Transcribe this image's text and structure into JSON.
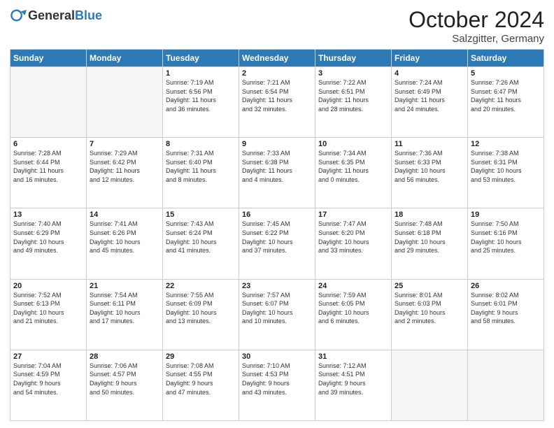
{
  "header": {
    "logo_general": "General",
    "logo_blue": "Blue",
    "month_title": "October 2024",
    "location": "Salzgitter, Germany"
  },
  "weekdays": [
    "Sunday",
    "Monday",
    "Tuesday",
    "Wednesday",
    "Thursday",
    "Friday",
    "Saturday"
  ],
  "weeks": [
    [
      {
        "day": "",
        "info": ""
      },
      {
        "day": "",
        "info": ""
      },
      {
        "day": "1",
        "info": "Sunrise: 7:19 AM\nSunset: 6:56 PM\nDaylight: 11 hours\nand 36 minutes."
      },
      {
        "day": "2",
        "info": "Sunrise: 7:21 AM\nSunset: 6:54 PM\nDaylight: 11 hours\nand 32 minutes."
      },
      {
        "day": "3",
        "info": "Sunrise: 7:22 AM\nSunset: 6:51 PM\nDaylight: 11 hours\nand 28 minutes."
      },
      {
        "day": "4",
        "info": "Sunrise: 7:24 AM\nSunset: 6:49 PM\nDaylight: 11 hours\nand 24 minutes."
      },
      {
        "day": "5",
        "info": "Sunrise: 7:26 AM\nSunset: 6:47 PM\nDaylight: 11 hours\nand 20 minutes."
      }
    ],
    [
      {
        "day": "6",
        "info": "Sunrise: 7:28 AM\nSunset: 6:44 PM\nDaylight: 11 hours\nand 16 minutes."
      },
      {
        "day": "7",
        "info": "Sunrise: 7:29 AM\nSunset: 6:42 PM\nDaylight: 11 hours\nand 12 minutes."
      },
      {
        "day": "8",
        "info": "Sunrise: 7:31 AM\nSunset: 6:40 PM\nDaylight: 11 hours\nand 8 minutes."
      },
      {
        "day": "9",
        "info": "Sunrise: 7:33 AM\nSunset: 6:38 PM\nDaylight: 11 hours\nand 4 minutes."
      },
      {
        "day": "10",
        "info": "Sunrise: 7:34 AM\nSunset: 6:35 PM\nDaylight: 11 hours\nand 0 minutes."
      },
      {
        "day": "11",
        "info": "Sunrise: 7:36 AM\nSunset: 6:33 PM\nDaylight: 10 hours\nand 56 minutes."
      },
      {
        "day": "12",
        "info": "Sunrise: 7:38 AM\nSunset: 6:31 PM\nDaylight: 10 hours\nand 53 minutes."
      }
    ],
    [
      {
        "day": "13",
        "info": "Sunrise: 7:40 AM\nSunset: 6:29 PM\nDaylight: 10 hours\nand 49 minutes."
      },
      {
        "day": "14",
        "info": "Sunrise: 7:41 AM\nSunset: 6:26 PM\nDaylight: 10 hours\nand 45 minutes."
      },
      {
        "day": "15",
        "info": "Sunrise: 7:43 AM\nSunset: 6:24 PM\nDaylight: 10 hours\nand 41 minutes."
      },
      {
        "day": "16",
        "info": "Sunrise: 7:45 AM\nSunset: 6:22 PM\nDaylight: 10 hours\nand 37 minutes."
      },
      {
        "day": "17",
        "info": "Sunrise: 7:47 AM\nSunset: 6:20 PM\nDaylight: 10 hours\nand 33 minutes."
      },
      {
        "day": "18",
        "info": "Sunrise: 7:48 AM\nSunset: 6:18 PM\nDaylight: 10 hours\nand 29 minutes."
      },
      {
        "day": "19",
        "info": "Sunrise: 7:50 AM\nSunset: 6:16 PM\nDaylight: 10 hours\nand 25 minutes."
      }
    ],
    [
      {
        "day": "20",
        "info": "Sunrise: 7:52 AM\nSunset: 6:13 PM\nDaylight: 10 hours\nand 21 minutes."
      },
      {
        "day": "21",
        "info": "Sunrise: 7:54 AM\nSunset: 6:11 PM\nDaylight: 10 hours\nand 17 minutes."
      },
      {
        "day": "22",
        "info": "Sunrise: 7:55 AM\nSunset: 6:09 PM\nDaylight: 10 hours\nand 13 minutes."
      },
      {
        "day": "23",
        "info": "Sunrise: 7:57 AM\nSunset: 6:07 PM\nDaylight: 10 hours\nand 10 minutes."
      },
      {
        "day": "24",
        "info": "Sunrise: 7:59 AM\nSunset: 6:05 PM\nDaylight: 10 hours\nand 6 minutes."
      },
      {
        "day": "25",
        "info": "Sunrise: 8:01 AM\nSunset: 6:03 PM\nDaylight: 10 hours\nand 2 minutes."
      },
      {
        "day": "26",
        "info": "Sunrise: 8:02 AM\nSunset: 6:01 PM\nDaylight: 9 hours\nand 58 minutes."
      }
    ],
    [
      {
        "day": "27",
        "info": "Sunrise: 7:04 AM\nSunset: 4:59 PM\nDaylight: 9 hours\nand 54 minutes."
      },
      {
        "day": "28",
        "info": "Sunrise: 7:06 AM\nSunset: 4:57 PM\nDaylight: 9 hours\nand 50 minutes."
      },
      {
        "day": "29",
        "info": "Sunrise: 7:08 AM\nSunset: 4:55 PM\nDaylight: 9 hours\nand 47 minutes."
      },
      {
        "day": "30",
        "info": "Sunrise: 7:10 AM\nSunset: 4:53 PM\nDaylight: 9 hours\nand 43 minutes."
      },
      {
        "day": "31",
        "info": "Sunrise: 7:12 AM\nSunset: 4:51 PM\nDaylight: 9 hours\nand 39 minutes."
      },
      {
        "day": "",
        "info": ""
      },
      {
        "day": "",
        "info": ""
      }
    ]
  ]
}
